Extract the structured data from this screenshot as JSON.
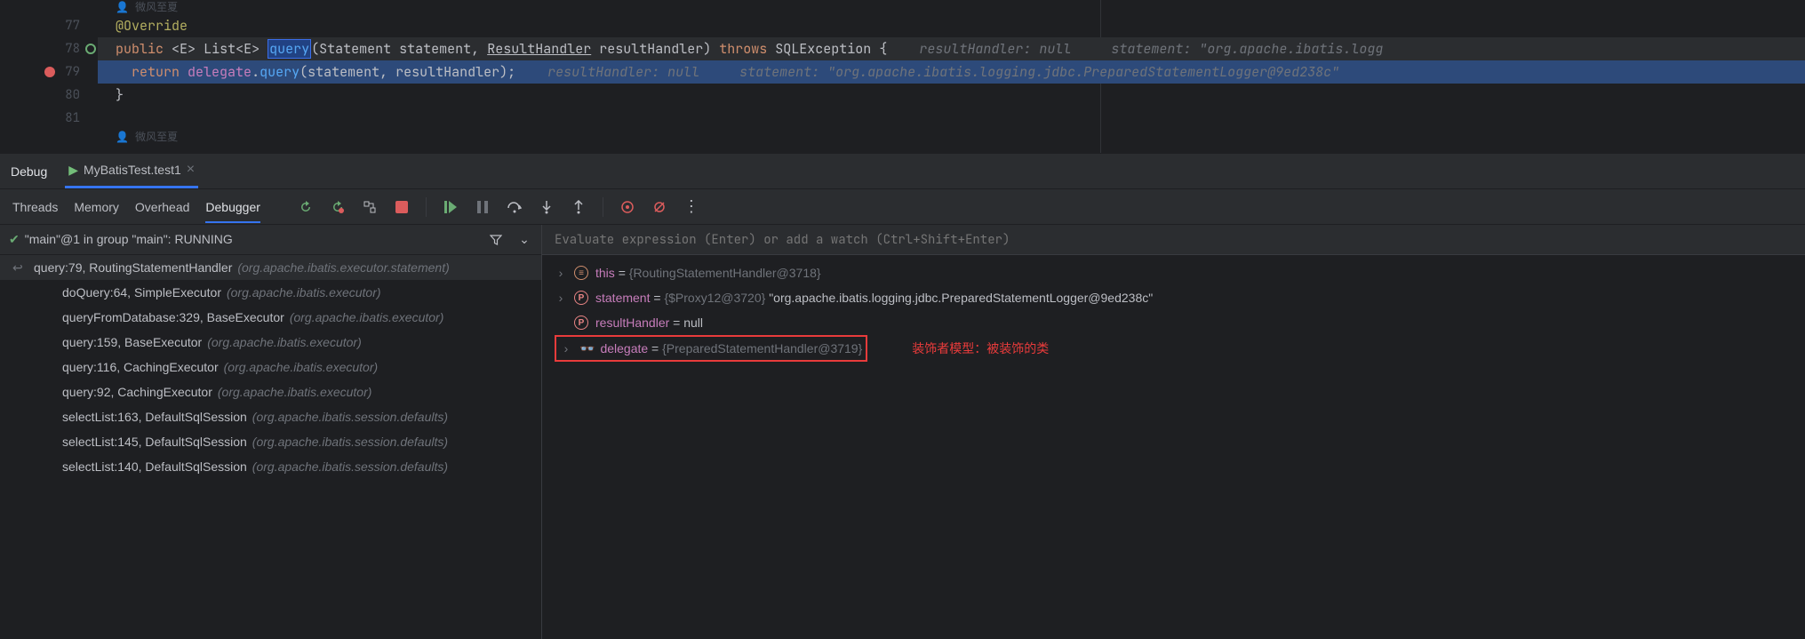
{
  "editor": {
    "author_top": "微风至夏",
    "author_bottom": "微风至夏",
    "lines": {
      "l77": "77",
      "l78": "78",
      "l79": "79",
      "l80": "80",
      "l81": "81"
    },
    "code": {
      "override": "@Override",
      "public": "public",
      "generic": "<E>",
      "list": "List<E>",
      "query": "query",
      "lparen": "(",
      "stmt_t": "Statement",
      "stmt_p": "statement",
      "comma": ", ",
      "rh_t": "ResultHandler",
      "rh_p": "resultHandler",
      "rparen": ")",
      "throws": "throws",
      "exc": "SQLException",
      "brace_o": "{",
      "return": "return",
      "delegate": "delegate",
      "dot": ".",
      "query2": "query",
      "args": "(statement, resultHandler);",
      "brace_c": "}"
    },
    "hints": {
      "rh78": "resultHandler: null",
      "st78": "statement: \"org.apache.ibatis.logg",
      "rh79": "resultHandler: null",
      "st79": "statement: \"org.apache.ibatis.logging.jdbc.PreparedStatementLogger@9ed238c\""
    }
  },
  "debug": {
    "title": "Debug",
    "tab": "MyBatisTest.test1",
    "toolbar": {
      "threads": "Threads",
      "memory": "Memory",
      "overhead": "Overhead",
      "debugger": "Debugger"
    },
    "frames_header": "\"main\"@1 in group \"main\": RUNNING",
    "frames": [
      {
        "loc": "query:79, RoutingStatementHandler",
        "pkg": "(org.apache.ibatis.executor.statement)",
        "selected": true,
        "icon": true
      },
      {
        "loc": "doQuery:64, SimpleExecutor",
        "pkg": "(org.apache.ibatis.executor)"
      },
      {
        "loc": "queryFromDatabase:329, BaseExecutor",
        "pkg": "(org.apache.ibatis.executor)"
      },
      {
        "loc": "query:159, BaseExecutor",
        "pkg": "(org.apache.ibatis.executor)"
      },
      {
        "loc": "query:116, CachingExecutor",
        "pkg": "(org.apache.ibatis.executor)"
      },
      {
        "loc": "query:92, CachingExecutor",
        "pkg": "(org.apache.ibatis.executor)"
      },
      {
        "loc": "selectList:163, DefaultSqlSession",
        "pkg": "(org.apache.ibatis.session.defaults)"
      },
      {
        "loc": "selectList:145, DefaultSqlSession",
        "pkg": "(org.apache.ibatis.session.defaults)"
      },
      {
        "loc": "selectList:140, DefaultSqlSession",
        "pkg": "(org.apache.ibatis.session.defaults)"
      }
    ],
    "eval_placeholder": "Evaluate expression (Enter) or add a watch (Ctrl+Shift+Enter)",
    "vars": {
      "this_name": "this",
      "this_val": "{RoutingStatementHandler@3718}",
      "stmt_name": "statement",
      "stmt_ref": "{$Proxy12@3720}",
      "stmt_str": "\"org.apache.ibatis.logging.jdbc.PreparedStatementLogger@9ed238c\"",
      "rh_name": "resultHandler",
      "rh_val": "null",
      "del_name": "delegate",
      "del_val": "{PreparedStatementHandler@3719}"
    },
    "annotation": "装饰者模型：被装饰的类"
  }
}
